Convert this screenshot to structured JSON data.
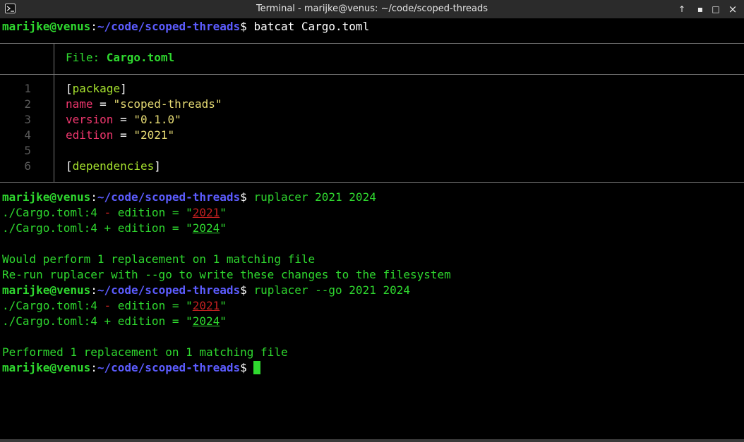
{
  "window": {
    "title": "Terminal - marijke@venus: ~/code/scoped-threads",
    "icon": "terminal-icon",
    "controls": {
      "up": "↑",
      "minimize": "▪",
      "maximize": "□",
      "close": "×"
    }
  },
  "prompt": {
    "user_host": "marijke@venus",
    "colon": ":",
    "path": "~/code/scoped-threads",
    "dollar": "$ "
  },
  "commands": {
    "batcat": "batcat Cargo.toml",
    "ruplacer_dry": "ruplacer 2021 2024",
    "ruplacer_go": "ruplacer --go 2021 2024"
  },
  "bat": {
    "file_label": "File: ",
    "file_name": "Cargo.toml",
    "lines": [
      {
        "num": "1",
        "open": "[",
        "section": "package",
        "close": "]"
      },
      {
        "num": "2",
        "key": "name",
        "eq": " = ",
        "value": "\"scoped-threads\""
      },
      {
        "num": "3",
        "key": "version",
        "eq": " = ",
        "value": "\"0.1.0\""
      },
      {
        "num": "4",
        "key": "edition",
        "eq": " = ",
        "value": "\"2021\""
      },
      {
        "num": "5"
      },
      {
        "num": "6",
        "open": "[",
        "section": "dependencies",
        "close": "]"
      }
    ]
  },
  "diff": {
    "file_loc": "./Cargo.toml:4",
    "minus": " - ",
    "plus": " + ",
    "prefix": "edition = \"",
    "old": "2021",
    "new": "2024",
    "suffix": "\""
  },
  "messages": {
    "would": "Would perform 1 replacement on 1 matching file",
    "rerun": "Re-run ruplacer with --go to write these changes to the filesystem",
    "performed": "Performed 1 replacement on 1 matching file"
  },
  "colors": {
    "prompt_user": "#2fd92f",
    "prompt_path": "#5c5cff",
    "added": "#2fd92f",
    "removed": "#c32020",
    "cursor": "#2fd92f"
  }
}
